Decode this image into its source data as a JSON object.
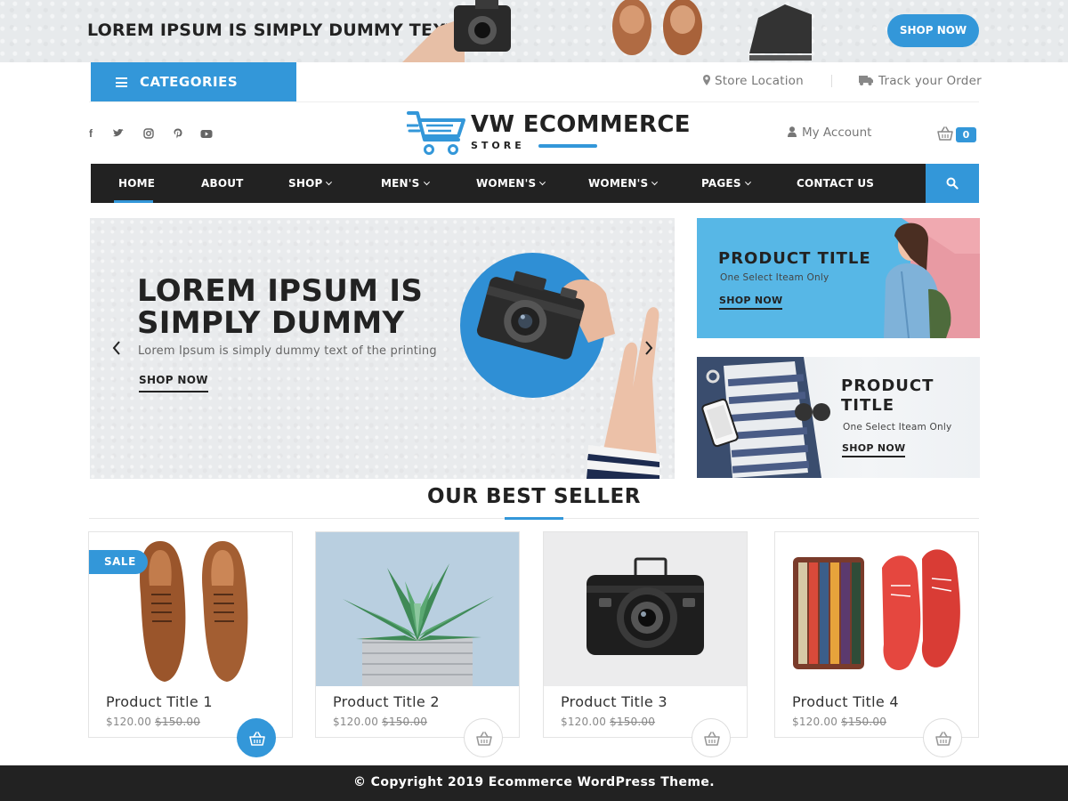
{
  "topbar": {
    "headline": "LOREM IPSUM IS SIMPLY DUMMY TEXT",
    "shop_label": "SHOP NOW"
  },
  "header": {
    "categories_label": "CATEGORIES",
    "store_location": "Store Location",
    "track_order": "Track your Order",
    "logo_title": "VW ECOMMERCE",
    "logo_sub": "STORE",
    "my_account": "My Account",
    "cart_count": "0",
    "social": [
      "facebook-icon",
      "twitter-icon",
      "instagram-icon",
      "pinterest-icon",
      "youtube-icon"
    ]
  },
  "nav": {
    "items": [
      {
        "label": "HOME"
      },
      {
        "label": "ABOUT"
      },
      {
        "label": "SHOP"
      },
      {
        "label": "MEN'S"
      },
      {
        "label": "WOMEN'S"
      },
      {
        "label": "WOMEN'S"
      },
      {
        "label": "PAGES"
      },
      {
        "label": "CONTACT US"
      }
    ]
  },
  "hero": {
    "title": "LOREM IPSUM IS SIMPLY DUMMY",
    "text": "Lorem Ipsum is simply dummy text of the printing",
    "shop_label": "SHOP NOW"
  },
  "promos": [
    {
      "title": "PRODUCT TITLE",
      "subtitle": "One  Select Iteam Only",
      "shop_label": "SHOP NOW"
    },
    {
      "title": "PRODUCT TITLE",
      "subtitle": "One  Select Iteam Only",
      "shop_label": "SHOP NOW"
    }
  ],
  "best_seller": {
    "title": "OUR BEST SELLER",
    "sale_badge": "SALE",
    "products": [
      {
        "name": "Product Title 1",
        "price": "$120.00",
        "old_price": "$150.00"
      },
      {
        "name": "Product Title 2",
        "price": "$120.00",
        "old_price": "$150.00"
      },
      {
        "name": "Product Title 3",
        "price": "$120.00",
        "old_price": "$150.00"
      },
      {
        "name": "Product Title 4",
        "price": "$120.00",
        "old_price": "$150.00"
      }
    ]
  },
  "footer": {
    "copyright": "© Copyright 2019 Ecommerce WordPress Theme."
  },
  "colors": {
    "accent": "#3397d9",
    "dark": "#222222"
  }
}
